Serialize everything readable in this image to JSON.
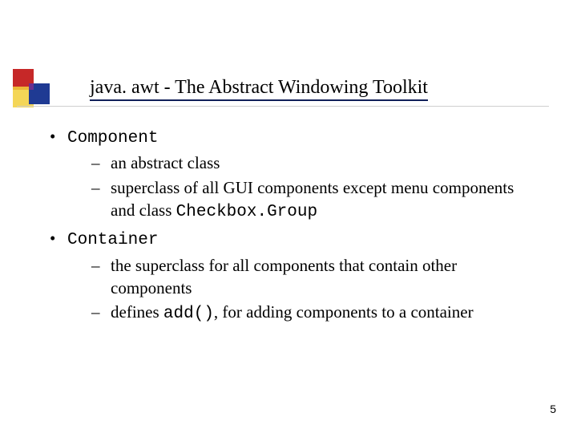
{
  "title": "java. awt - The Abstract Windowing Toolkit",
  "bullets": [
    {
      "term": "Component",
      "sub": [
        {
          "pre": "an abstract class"
        },
        {
          "pre": "superclass of all GUI components except menu components and class ",
          "code": "Checkbox.Group"
        }
      ]
    },
    {
      "term": "Container",
      "sub": [
        {
          "pre": "the superclass for all components that contain other components"
        },
        {
          "pre": "defines ",
          "code": "add()",
          "post": ", for adding components to a container"
        }
      ]
    }
  ],
  "page_number": "5"
}
